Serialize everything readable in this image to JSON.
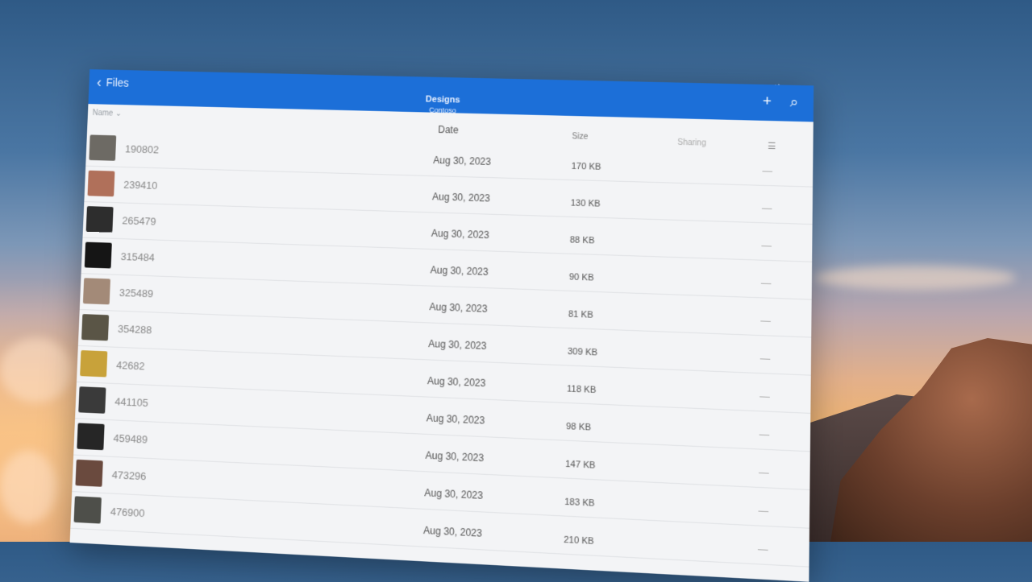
{
  "window": {
    "back_label": "Files",
    "title": "Designs",
    "subtitle": "Contoso",
    "sort_label": "Name",
    "columns": {
      "date": "Date",
      "size": "Size",
      "sharing": "Sharing"
    }
  },
  "files": [
    {
      "name": "190802",
      "date": "Aug 30, 2023",
      "size": "170 KB",
      "thumb": "#6d6a64"
    },
    {
      "name": "239410",
      "date": "Aug 30, 2023",
      "size": "130 KB",
      "thumb": "#b0705a"
    },
    {
      "name": "265479",
      "date": "Aug 30, 2023",
      "size": "88 KB",
      "thumb": "#2d2d2d"
    },
    {
      "name": "315484",
      "date": "Aug 30, 2023",
      "size": "90 KB",
      "thumb": "#151515"
    },
    {
      "name": "325489",
      "date": "Aug 30, 2023",
      "size": "81 KB",
      "thumb": "#a38a78"
    },
    {
      "name": "354288",
      "date": "Aug 30, 2023",
      "size": "309 KB",
      "thumb": "#5a5546"
    },
    {
      "name": "42682",
      "date": "Aug 30, 2023",
      "size": "118 KB",
      "thumb": "#c8a23a"
    },
    {
      "name": "441105",
      "date": "Aug 30, 2023",
      "size": "98 KB",
      "thumb": "#3a3a3a"
    },
    {
      "name": "459489",
      "date": "Aug 30, 2023",
      "size": "147 KB",
      "thumb": "#262626"
    },
    {
      "name": "473296",
      "date": "Aug 30, 2023",
      "size": "183 KB",
      "thumb": "#6a4a3e"
    },
    {
      "name": "476900",
      "date": "Aug 30, 2023",
      "size": "210 KB",
      "thumb": "#4e4f4a"
    }
  ]
}
